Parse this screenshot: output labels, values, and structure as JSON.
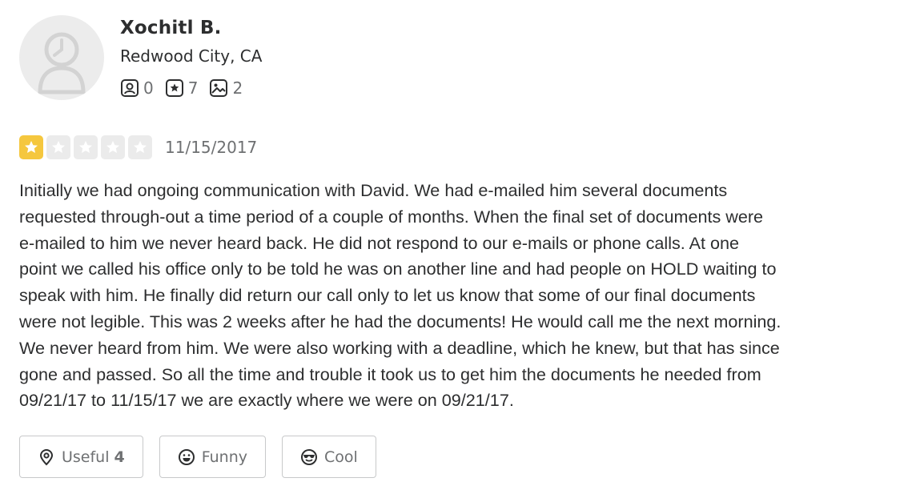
{
  "user": {
    "name": "Xochitl B.",
    "location": "Redwood City, CA",
    "stats": [
      {
        "icon": "friends-icon",
        "value": "0"
      },
      {
        "icon": "reviews-icon",
        "value": "7"
      },
      {
        "icon": "photos-icon",
        "value": "2"
      }
    ]
  },
  "review": {
    "rating": 1,
    "max_rating": 5,
    "date": "11/15/2017",
    "text": "Initially we had ongoing communication with David.  We had e-mailed him several documents\nrequested through-out a time period of a couple of months.  When the final set of documents were\ne-mailed to him we never heard back.  He did not respond to our e-mails or phone calls.  At one\npoint we called his office only to be told he was on another line and had people on HOLD waiting to\nspeak with him.  He finally did return our call only to let us know that some of our final documents\nwere not legible.  This was 2 weeks after he had the documents!  He would call me the next morning.\n We never heard from him.  We were also working with a deadline, which he knew, but that has since\ngone and passed.  So all the time and trouble it took us to get him the documents he needed from\n09/21/17 to 11/15/17 we are exactly where we were on 09/21/17."
  },
  "actions": {
    "useful": {
      "label": "Useful",
      "count": "4"
    },
    "funny": {
      "label": "Funny"
    },
    "cool": {
      "label": "Cool"
    }
  },
  "colors": {
    "star_filled": "#f5c73e",
    "star_empty": "#ebebeb",
    "text": "#2d2e2f",
    "muted": "#6e7072"
  }
}
